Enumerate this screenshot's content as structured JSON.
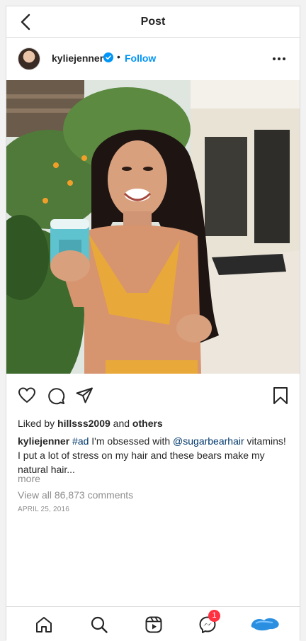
{
  "topbar": {
    "title": "Post",
    "back_icon": "chevron-left-icon"
  },
  "post": {
    "username": "kyliejenner",
    "dot": "•",
    "follow_label": "Follow",
    "likes": {
      "prefix": "Liked by",
      "user": "hillsss2009",
      "and": "and",
      "others": "others"
    },
    "caption": {
      "username": "kyliejenner",
      "hashtag": "#ad",
      "text_1": "I'm obsessed with",
      "mention": "@sugarbearhair",
      "text_2": "vitamins! I put a lot of stress on my hair and these bears make my natural hair..."
    },
    "more_label": "more",
    "view_comments": "View all 86,873 comments",
    "date": "APRIL 25, 2016"
  },
  "bottom_nav": {
    "items": [
      "home-icon",
      "search-icon",
      "reels-icon",
      "messenger-icon",
      "profile-avatar"
    ],
    "messenger_badge": "1"
  },
  "colors": {
    "accent": "#0095f6",
    "badge": "#ff3040",
    "muted": "#8e8e8e",
    "link": "#00376b"
  }
}
